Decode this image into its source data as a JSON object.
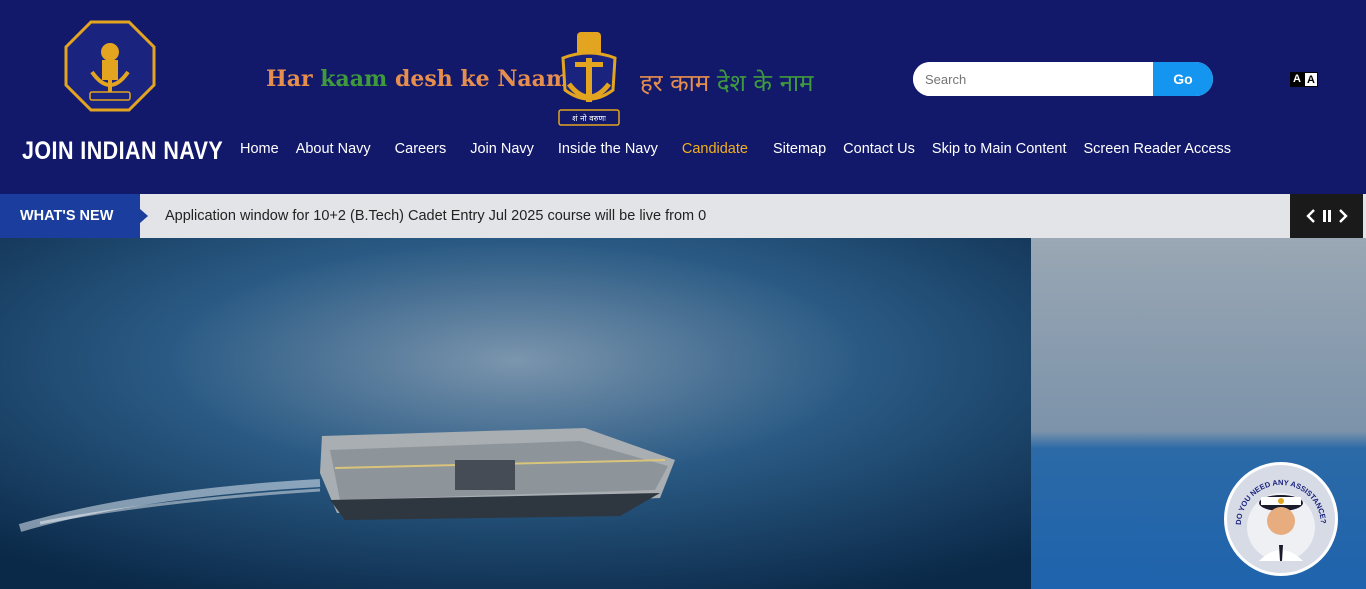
{
  "header": {
    "site_title": "JOIN INDIAN NAVY",
    "slogan_en": {
      "w1": "Har ",
      "w2": "kaam ",
      "w3": "desh ke Naam"
    },
    "slogan_hi": {
      "h1": "हर काम ",
      "h2": "देश के नाम"
    },
    "emblem_motto": "शं नो वरुणः"
  },
  "search": {
    "placeholder": "Search",
    "value": "",
    "go_label": "Go"
  },
  "font_toggle": {
    "small": "A",
    "large": "A"
  },
  "nav": {
    "items": [
      {
        "label": "Home"
      },
      {
        "label": "About Navy"
      },
      {
        "label": "Careers"
      },
      {
        "label": "Join Navy"
      },
      {
        "label": "Inside the Navy"
      },
      {
        "label": "Candidate"
      },
      {
        "label": "Sitemap"
      },
      {
        "label": "Contact Us"
      },
      {
        "label": "Skip to Main Content"
      },
      {
        "label": "Screen Reader Access"
      }
    ],
    "active_index": 5
  },
  "ticker": {
    "label": "WHAT'S NEW",
    "text": "Application window for 10+2 (B.Tech) Cadet Entry Jul 2025 course will be live from 0"
  },
  "assistant": {
    "text": "DO YOU NEED ANY ASSISTANCE?"
  },
  "colors": {
    "header_bg": "#12196b",
    "accent": "#f3b01c",
    "go_button": "#1495f0",
    "ticker_label_bg": "#1a3d9e"
  }
}
